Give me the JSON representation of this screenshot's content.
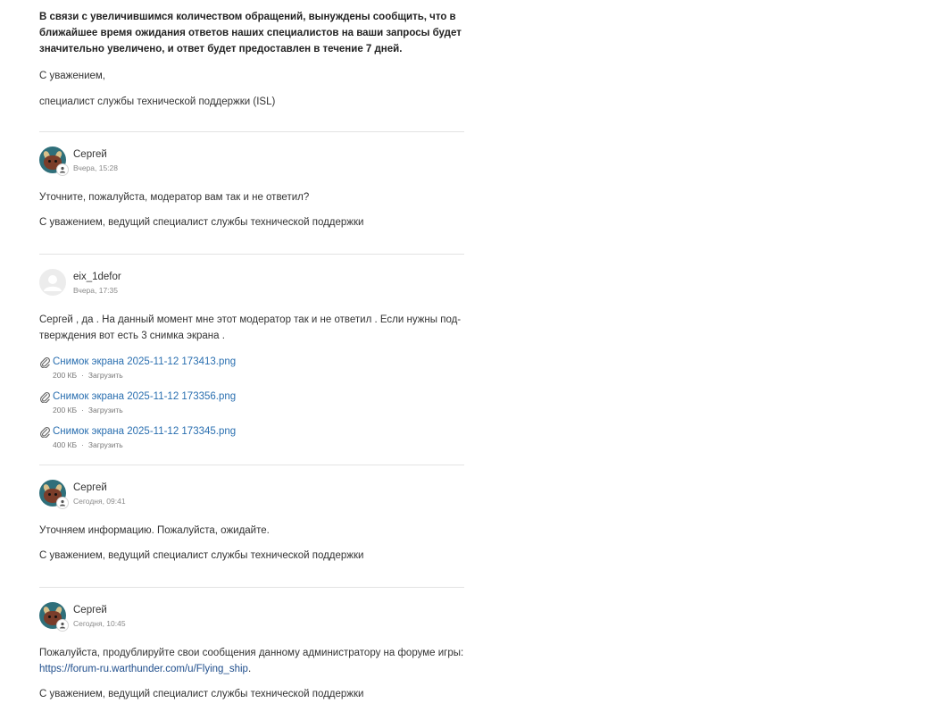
{
  "intro": {
    "notice": "В связи с увеличившимся количеством обращений, вынуждены сообщить, что в ближайшее время ожидания ответов наших специалистов на ваши запросы будет значительно увеличено, и ответ будет предоставлен в течение 7 дней.",
    "regards": "С уважением,",
    "signature": "специалист службы технической поддержки (ISL)"
  },
  "posts": [
    {
      "author": "Сергей",
      "time": "Вчера, 15:28",
      "avatar": "sergey-avatar",
      "text": "Уточните, пожалуйста, модератор вам так и не ответил?",
      "signature": "С уважением, ведущий специалист службы технической поддержки"
    },
    {
      "author": "eix_1defor",
      "time": "Вчера, 17:35",
      "avatar": "default-user-avatar",
      "text": "Сергей , да . На данный момент мне этот модератор так и не ответил . Если нужны под-тверждения вот есть 3 снимка экрана .",
      "attachments": [
        {
          "name": "Снимок экрана 2025-11-12 173413.png",
          "size": "200 КБ",
          "download": "Загрузить"
        },
        {
          "name": "Снимок экрана 2025-11-12 173356.png",
          "size": "200 КБ",
          "download": "Загрузить"
        },
        {
          "name": "Снимок экрана 2025-11-12 173345.png",
          "size": "400 КБ",
          "download": "Загрузить"
        }
      ]
    },
    {
      "author": "Сергей",
      "time": "Сегодня, 09:41",
      "avatar": "sergey-avatar",
      "text": "Уточняем информацию. Пожалуйста, ожидайте.",
      "signature": "С уважением, ведущий специалист службы технической поддержки"
    },
    {
      "author": "Сергей",
      "time": "Сегодня, 10:45",
      "avatar": "sergey-avatar",
      "text_before_link": "Пожалуйста, продублируйте свои сообщения данному администратору на форуме игры: ",
      "link": "https://forum-ru.warthunder.com/u/Flying_ship",
      "text_after_link": ".",
      "signature": "С уважением, ведущий специалист службы технической поддержки"
    }
  ],
  "separator": "·",
  "colors": {
    "link": "#1f4e8c",
    "attachment": "#2a6fb0",
    "divider": "#e3e3e3",
    "muted": "#8a8a8a"
  }
}
